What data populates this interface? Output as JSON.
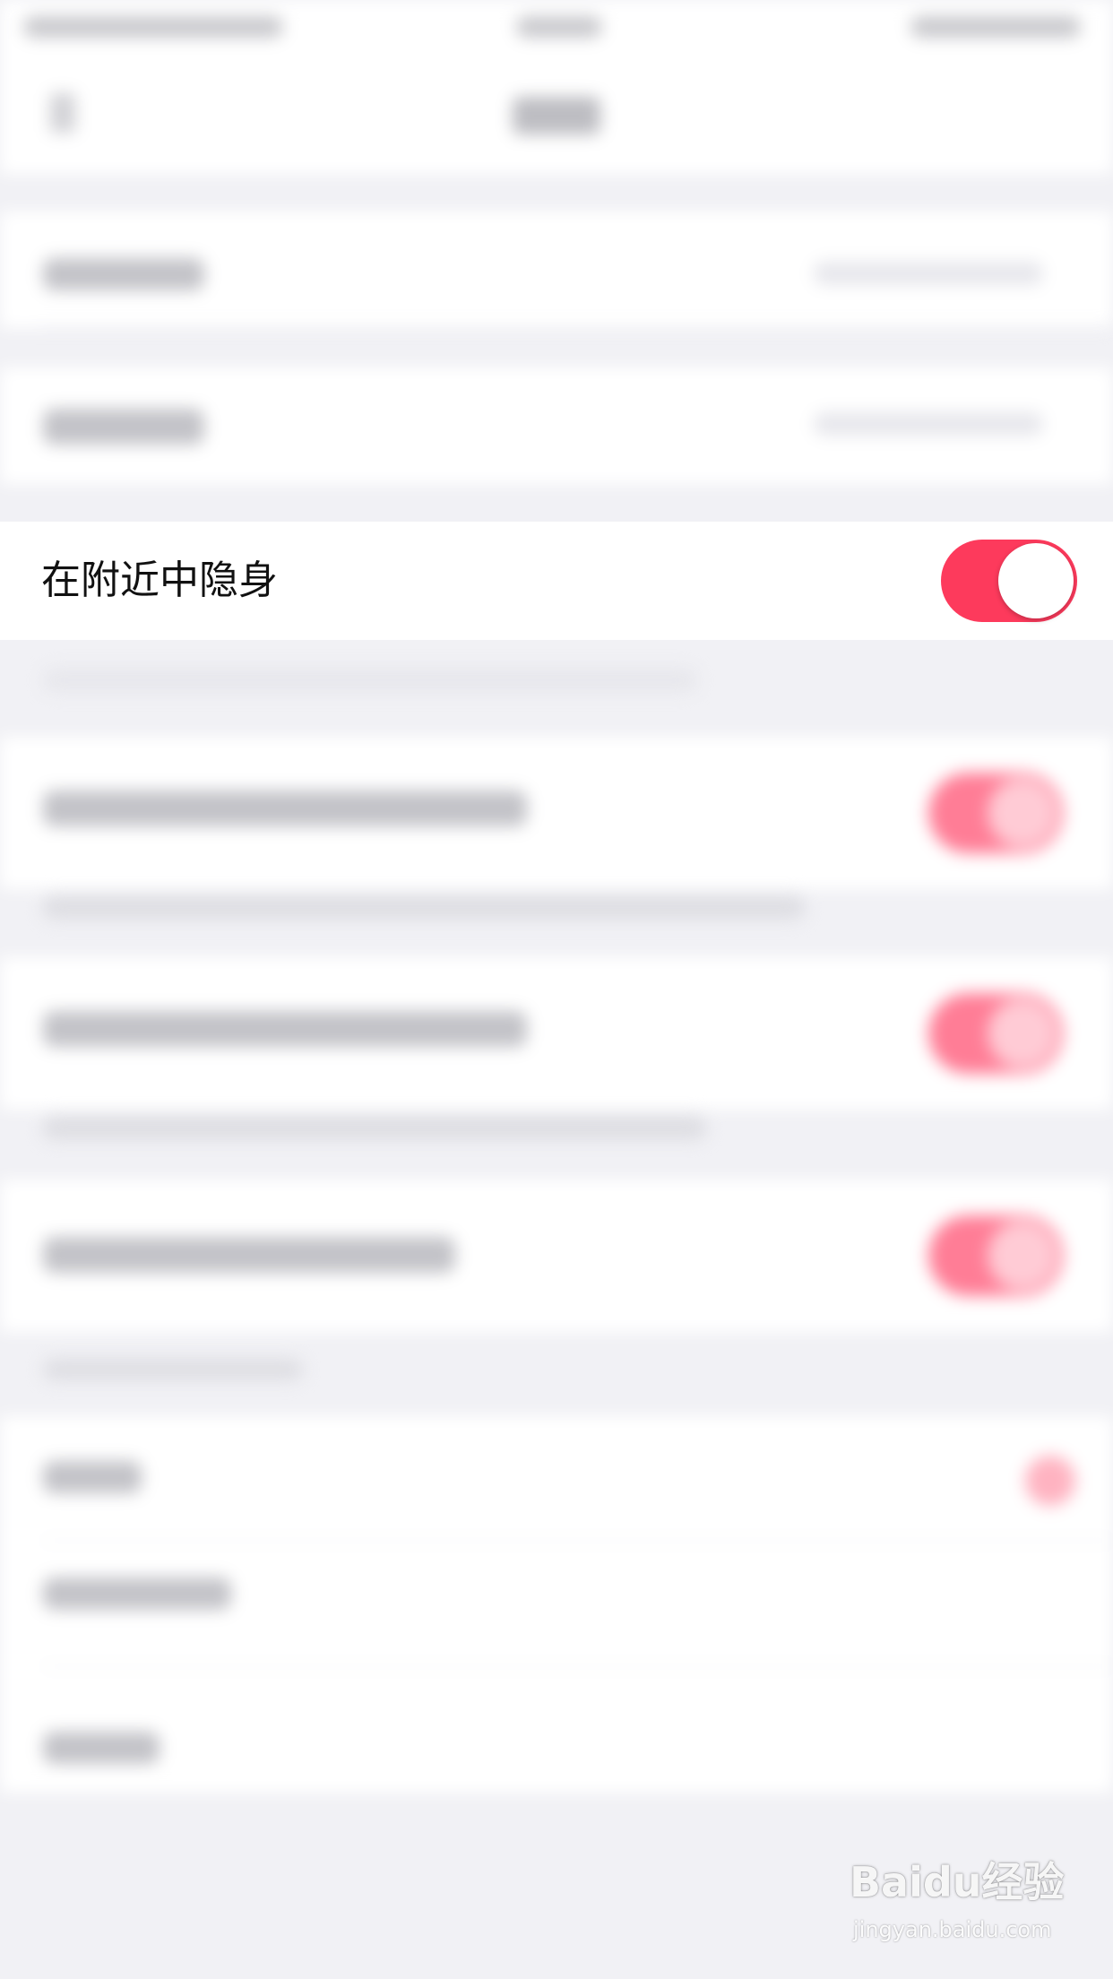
{
  "app": {
    "accent_color": "#fd3a5c"
  },
  "invisible_nearby": {
    "label": "在附近中隐身",
    "toggle_on": true,
    "toggle_color": "#fd3a5c"
  },
  "watermark": {
    "logo": "Baidu经验",
    "url": "jingyan.baidu.com"
  }
}
